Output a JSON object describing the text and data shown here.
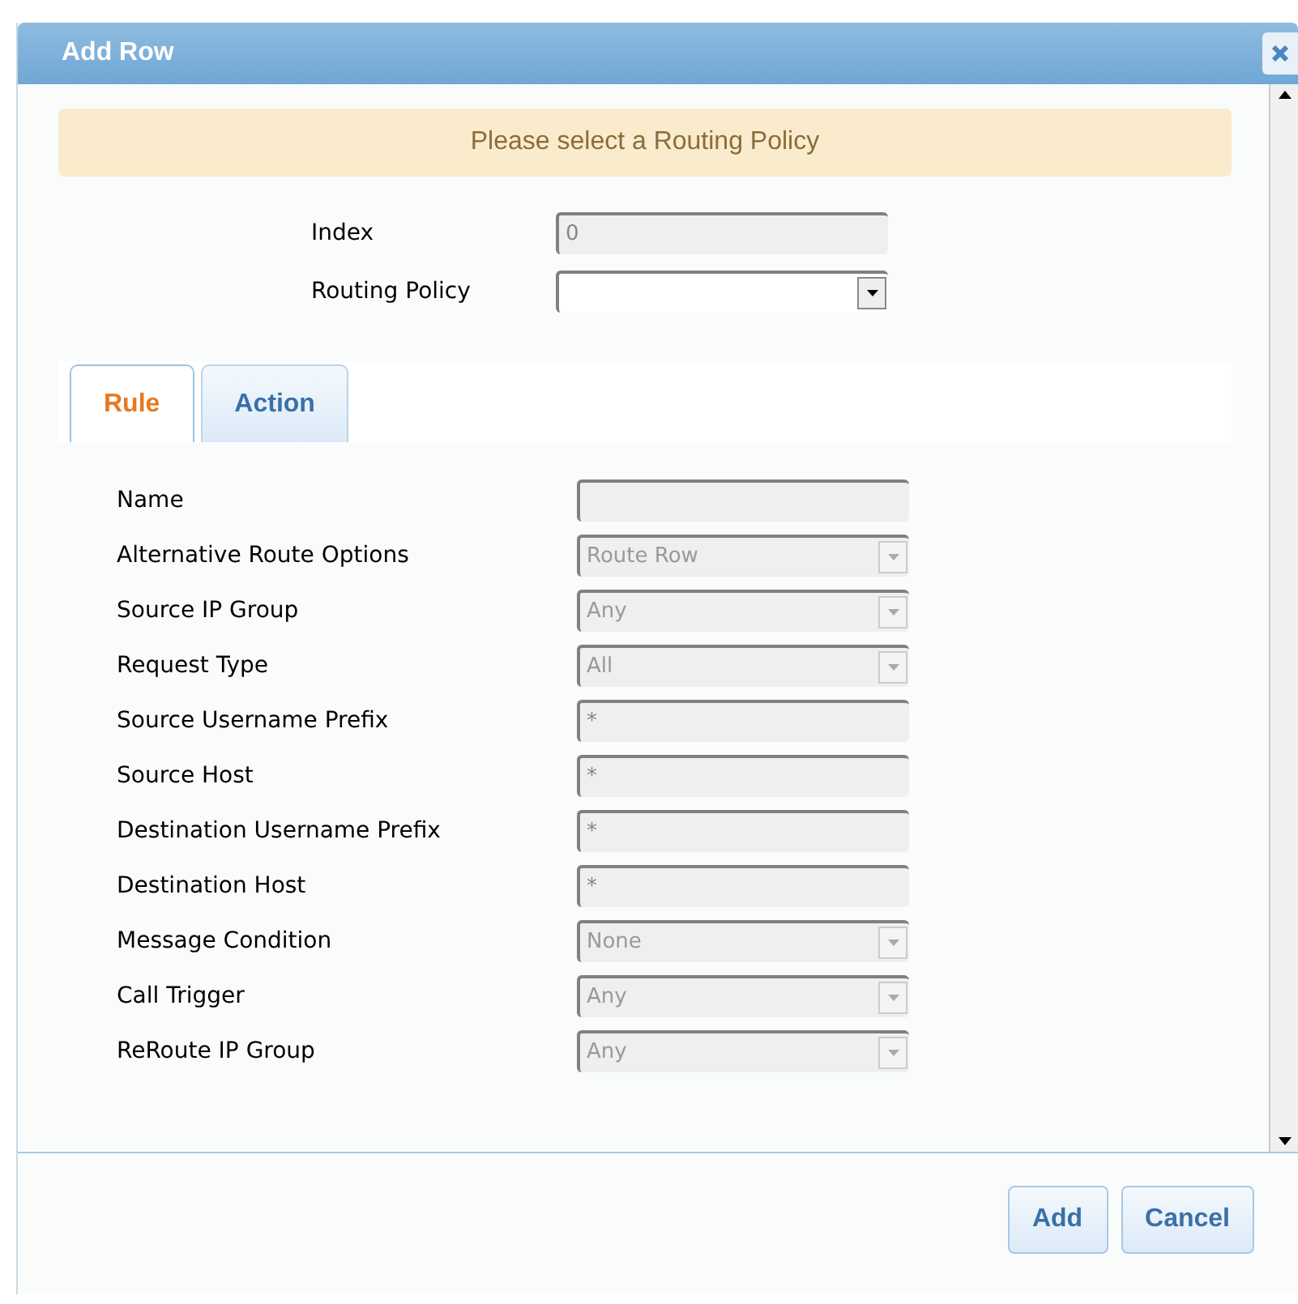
{
  "window": {
    "title": "Add Row"
  },
  "alert": "Please select a Routing Policy",
  "top_fields": [
    {
      "label": "Index",
      "kind": "text",
      "value": "0"
    },
    {
      "label": "Routing Policy",
      "kind": "select"
    }
  ],
  "tabs": [
    {
      "label": "Rule",
      "selected": true
    },
    {
      "label": "Action",
      "selected": false
    }
  ],
  "fields": [
    {
      "label": "Name",
      "kind": "text"
    },
    {
      "label": "Alternative Route Options",
      "kind": "select",
      "value": "Route Row"
    },
    {
      "label": "Source IP Group",
      "kind": "select",
      "value": "Any"
    },
    {
      "label": "Request Type",
      "kind": "select",
      "value": "All"
    },
    {
      "label": "Source Username Prefix",
      "kind": "text",
      "value": "*"
    },
    {
      "label": "Source Host",
      "kind": "text",
      "value": "*"
    },
    {
      "label": "Destination Username Prefix",
      "kind": "text",
      "value": "*"
    },
    {
      "label": "Destination Host",
      "kind": "text",
      "value": "*"
    },
    {
      "label": "Message Condition",
      "kind": "select",
      "value": "None"
    },
    {
      "label": "Call Trigger",
      "kind": "select",
      "value": "Any"
    },
    {
      "label": "ReRoute IP Group",
      "kind": "select",
      "value": "Any"
    }
  ],
  "buttons": [
    "Add",
    "Cancel"
  ]
}
